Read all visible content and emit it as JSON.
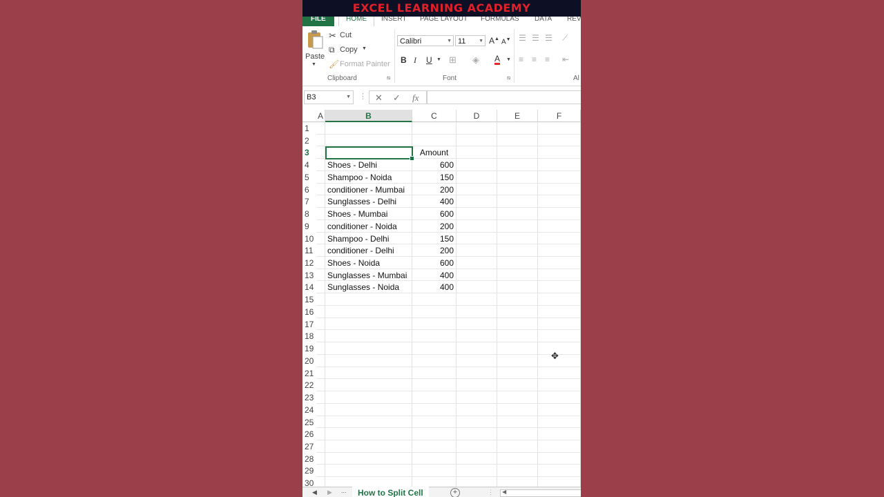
{
  "banner": {
    "title": "EXCEL LEARNING ACADEMY"
  },
  "ribbon_tabs": [
    "FILE",
    "HOME",
    "INSERT",
    "PAGE LAYOUT",
    "FORMULAS",
    "DATA",
    "REV"
  ],
  "clipboard": {
    "paste": "Paste",
    "cut": "Cut",
    "copy": "Copy",
    "format_painter": "Format Painter",
    "group_label": "Clipboard"
  },
  "font": {
    "name": "Calibri",
    "size": "11",
    "group_label": "Font",
    "bold": "B",
    "italic": "I",
    "underline": "U",
    "font_color_letter": "A",
    "grow": "A",
    "shrink": "A",
    "font_color": "#e02b2b"
  },
  "alignment": {
    "group_label": "Al"
  },
  "formula_bar": {
    "name_box": "B3",
    "cancel_symbol": "✕",
    "enter_symbol": "✓",
    "fx_label": "fx",
    "formula": ""
  },
  "columns": [
    "A",
    "B",
    "C",
    "D",
    "E",
    "F"
  ],
  "selected_column": "B",
  "header_row": {
    "row": "3",
    "b": "",
    "c": "Amount"
  },
  "rows": [
    {
      "n": "1",
      "b": "",
      "c": ""
    },
    {
      "n": "2",
      "b": "",
      "c": ""
    },
    {
      "n": "3",
      "b": "",
      "c": "Amount"
    },
    {
      "n": "4",
      "b": "Shoes - Delhi",
      "c": "600"
    },
    {
      "n": "5",
      "b": "Shampoo - Noida",
      "c": "150"
    },
    {
      "n": "6",
      "b": "conditioner - Mumbai",
      "c": "200"
    },
    {
      "n": "7",
      "b": "Sunglasses - Delhi",
      "c": "400"
    },
    {
      "n": "8",
      "b": "Shoes - Mumbai",
      "c": "600"
    },
    {
      "n": "9",
      "b": "conditioner - Noida",
      "c": "200"
    },
    {
      "n": "10",
      "b": "Shampoo - Delhi",
      "c": "150"
    },
    {
      "n": "11",
      "b": "conditioner - Delhi",
      "c": "200"
    },
    {
      "n": "12",
      "b": "Shoes - Noida",
      "c": "600"
    },
    {
      "n": "13",
      "b": "Sunglasses - Mumbai",
      "c": "400"
    },
    {
      "n": "14",
      "b": "Sunglasses - Noida",
      "c": "400"
    },
    {
      "n": "15",
      "b": "",
      "c": ""
    },
    {
      "n": "16",
      "b": "",
      "c": ""
    },
    {
      "n": "17",
      "b": "",
      "c": ""
    },
    {
      "n": "18",
      "b": "",
      "c": ""
    },
    {
      "n": "19",
      "b": "",
      "c": ""
    },
    {
      "n": "20",
      "b": "",
      "c": ""
    },
    {
      "n": "21",
      "b": "",
      "c": ""
    },
    {
      "n": "22",
      "b": "",
      "c": ""
    },
    {
      "n": "23",
      "b": "",
      "c": ""
    },
    {
      "n": "24",
      "b": "",
      "c": ""
    },
    {
      "n": "25",
      "b": "",
      "c": ""
    },
    {
      "n": "26",
      "b": "",
      "c": ""
    },
    {
      "n": "27",
      "b": "",
      "c": ""
    },
    {
      "n": "28",
      "b": "",
      "c": ""
    },
    {
      "n": "29",
      "b": "",
      "c": ""
    },
    {
      "n": "30",
      "b": "",
      "c": ""
    }
  ],
  "sheet": {
    "tab_label": "How to Split Cell",
    "more": "...",
    "add": "+"
  },
  "colors": {
    "excel_green": "#217346",
    "background": "#9b404a",
    "banner_bg": "#0d0f24",
    "banner_text": "#e0202a"
  }
}
